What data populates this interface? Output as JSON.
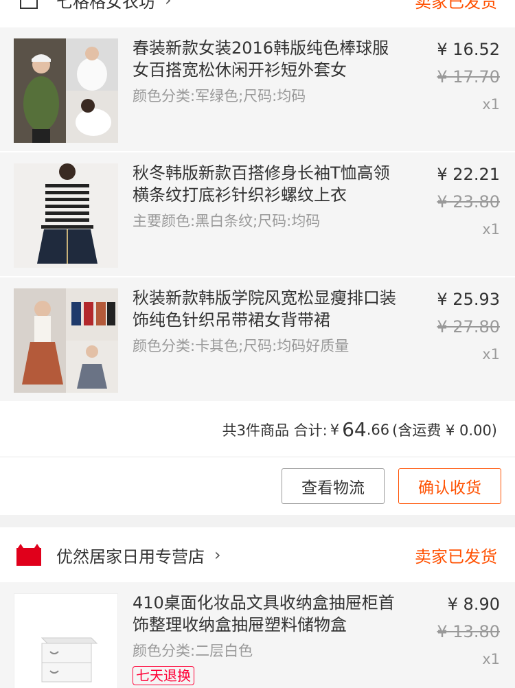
{
  "orders": [
    {
      "shop": {
        "name": "七格格女衣坊",
        "status": "卖家已发货"
      },
      "items": [
        {
          "title": "春装新款女装2016韩版纯色棒球服女百搭宽松休闲开衫短外套女",
          "sku": "颜色分类:军绿色;尺码:均码",
          "price": "¥ 16.52",
          "old_price": "¥ 17.70",
          "qty": "x1"
        },
        {
          "title": "秋冬韩版新款百搭修身长袖T恤高领横条纹打底衫针织衫螺纹上衣",
          "sku": "主要颜色:黑白条纹;尺码:均码",
          "price": "¥ 22.21",
          "old_price": "¥ 23.80",
          "qty": "x1"
        },
        {
          "title": "秋装新款韩版学院风宽松显瘦排口装饰纯色针织吊带裙女背带裙",
          "sku": "颜色分类:卡其色;尺码:均码好质量",
          "price": "¥ 25.93",
          "old_price": "¥ 27.80",
          "qty": "x1"
        }
      ],
      "summary": {
        "count_text": "共3件商品 合计:",
        "currency": "¥",
        "total_big": "64",
        "total_small": ".66",
        "shipping": "(含运费 ¥ 0.00)"
      },
      "actions": {
        "logistics": "查看物流",
        "confirm": "确认收货"
      }
    },
    {
      "shop": {
        "name": "优然居家日用专营店",
        "status": "卖家已发货",
        "badge": "天猫"
      },
      "items": [
        {
          "title": "410桌面化妆品文具收纳盒抽屉柜首饰整理收纳盒抽屉塑料储物盒",
          "sku": "颜色分类:二层白色",
          "price": "¥ 8.90",
          "old_price": "¥ 13.80",
          "qty": "x1",
          "tag": "七天退换"
        }
      ]
    }
  ],
  "icons": {
    "shop": "store-icon",
    "tmall": "tmall-logo-icon",
    "chevron": "chevron-right-icon"
  },
  "colors": {
    "accent": "#ff5000",
    "tmall_red": "#ff0036"
  }
}
